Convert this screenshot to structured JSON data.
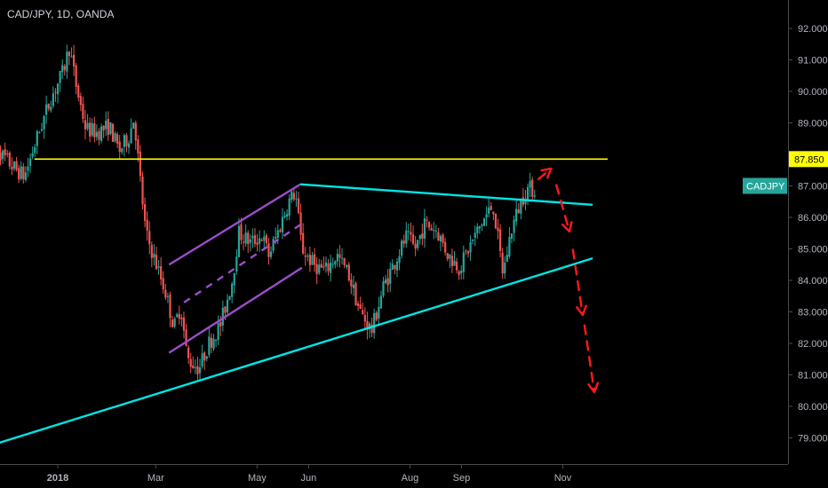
{
  "header": {
    "title": "CAD/JPY, 1D, OANDA"
  },
  "colors": {
    "background": "#000000",
    "bull": "#26a69a",
    "bear": "#ef5350",
    "resistance": "#ffff00",
    "trendline": "#00e5e5",
    "channel": "#9c4dcc",
    "arrow": "#ff1a1a",
    "symbol_badge": "#26a69a",
    "grid_text": "#b2b5be"
  },
  "icons": {
    "arrow": "red-dashed-arrow"
  },
  "chart_data": {
    "type": "candlestick",
    "symbol_label": "CADJPY",
    "price_label": "87.850",
    "y_ticks": [
      "92.000",
      "91.000",
      "90.000",
      "89.000",
      "88.000",
      "87.000",
      "86.000",
      "85.000",
      "84.000",
      "83.000",
      "82.000",
      "81.000",
      "80.000",
      "79.000"
    ],
    "ylim": [
      78.3,
      92.6
    ],
    "x_ticks": [
      {
        "label": "2018",
        "date": "2018-01-01",
        "bold": true
      },
      {
        "label": "Mar",
        "date": "2018-03-01",
        "bold": false
      },
      {
        "label": "May",
        "date": "2018-05-01",
        "bold": false
      },
      {
        "label": "Jun",
        "date": "2018-06-01",
        "bold": false
      },
      {
        "label": "Aug",
        "date": "2018-08-01",
        "bold": false
      },
      {
        "label": "Sep",
        "date": "2018-09-01",
        "bold": false
      },
      {
        "label": "Nov",
        "date": "2018-11-01",
        "bold": false
      }
    ],
    "xlim": [
      "2017-11-22",
      "2018-11-28"
    ],
    "price_path": [
      [
        "2017-11-22",
        88.6
      ],
      [
        "2017-11-28",
        88.0
      ],
      [
        "2017-12-05",
        87.6
      ],
      [
        "2017-12-12",
        87.3
      ],
      [
        "2017-12-20",
        88.6
      ],
      [
        "2017-12-28",
        89.8
      ],
      [
        "2018-01-04",
        90.6
      ],
      [
        "2018-01-08",
        91.4
      ],
      [
        "2018-01-12",
        90.2
      ],
      [
        "2018-01-18",
        88.8
      ],
      [
        "2018-01-25",
        88.7
      ],
      [
        "2018-02-01",
        88.9
      ],
      [
        "2018-02-07",
        88.1
      ],
      [
        "2018-02-13",
        88.6
      ],
      [
        "2018-02-16",
        89.2
      ],
      [
        "2018-02-19",
        87.5
      ],
      [
        "2018-02-23",
        85.5
      ],
      [
        "2018-03-02",
        84.4
      ],
      [
        "2018-03-07",
        83.6
      ],
      [
        "2018-03-12",
        82.5
      ],
      [
        "2018-03-16",
        83.2
      ],
      [
        "2018-03-20",
        81.5
      ],
      [
        "2018-03-27",
        81.2
      ],
      [
        "2018-04-02",
        82.0
      ],
      [
        "2018-04-09",
        82.6
      ],
      [
        "2018-04-16",
        84.0
      ],
      [
        "2018-04-20",
        85.5
      ],
      [
        "2018-04-27",
        85.2
      ],
      [
        "2018-05-04",
        85.4
      ],
      [
        "2018-05-08",
        84.8
      ],
      [
        "2018-05-14",
        85.6
      ],
      [
        "2018-05-20",
        86.5
      ],
      [
        "2018-05-24",
        86.8
      ],
      [
        "2018-05-28",
        85.0
      ],
      [
        "2018-06-04",
        84.5
      ],
      [
        "2018-06-11",
        84.3
      ],
      [
        "2018-06-18",
        84.8
      ],
      [
        "2018-06-25",
        84.2
      ],
      [
        "2018-07-02",
        83.0
      ],
      [
        "2018-07-09",
        82.4
      ],
      [
        "2018-07-16",
        83.8
      ],
      [
        "2018-07-23",
        84.6
      ],
      [
        "2018-07-30",
        85.4
      ],
      [
        "2018-08-04",
        85.0
      ],
      [
        "2018-08-10",
        85.8
      ],
      [
        "2018-08-17",
        85.6
      ],
      [
        "2018-08-24",
        84.8
      ],
      [
        "2018-08-31",
        84.4
      ],
      [
        "2018-09-07",
        85.2
      ],
      [
        "2018-09-13",
        85.8
      ],
      [
        "2018-09-20",
        86.4
      ],
      [
        "2018-09-26",
        84.2
      ],
      [
        "2018-10-01",
        85.6
      ],
      [
        "2018-10-06",
        86.4
      ],
      [
        "2018-10-10",
        86.9
      ],
      [
        "2018-10-16",
        86.9
      ]
    ],
    "lines": [
      {
        "role": "resistance",
        "from": [
          "2017-12-18",
          87.85
        ],
        "to": [
          "2018-11-28",
          87.85
        ]
      },
      {
        "role": "upper-trendline",
        "from": [
          "2018-05-27",
          87.05
        ],
        "to": [
          "2018-11-19",
          86.4
        ]
      },
      {
        "role": "lower-trendline",
        "from": [
          "2017-11-24",
          78.8
        ],
        "to": [
          "2018-11-19",
          84.7
        ]
      },
      {
        "role": "channel-upper",
        "from": [
          "2018-03-09",
          84.5
        ],
        "to": [
          "2018-05-27",
          87.05
        ]
      },
      {
        "role": "channel-lower",
        "from": [
          "2018-03-09",
          81.7
        ],
        "to": [
          "2018-05-28",
          84.4
        ]
      },
      {
        "role": "channel-mid",
        "from": [
          "2018-03-18",
          83.3
        ],
        "to": [
          "2018-05-28",
          85.8
        ]
      }
    ],
    "projection_arrows": [
      {
        "from": [
          "2018-10-17",
          87.2
        ],
        "to": [
          "2018-10-25",
          87.55
        ]
      },
      {
        "from": [
          "2018-10-28",
          87.05
        ],
        "to": [
          "2018-11-05",
          85.55
        ]
      },
      {
        "from": [
          "2018-11-07",
          85.0
        ],
        "to": [
          "2018-11-13",
          82.9
        ]
      },
      {
        "from": [
          "2018-11-14",
          82.6
        ],
        "to": [
          "2018-11-20",
          80.45
        ]
      }
    ]
  }
}
